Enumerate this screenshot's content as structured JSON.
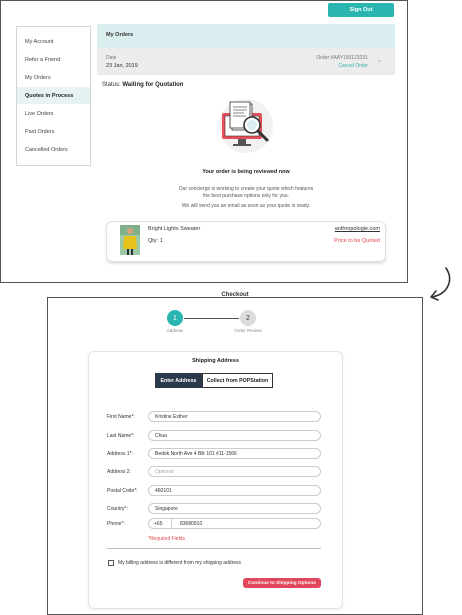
{
  "top": {
    "sign_out": "Sign Out",
    "sidebar": [
      "My Account",
      "Refer a Friend",
      "My Orders",
      "Quotes in Process",
      "Live Orders",
      "Past Orders",
      "Cancelled Orders"
    ],
    "orders_title": "My Orders",
    "date_label": "Date",
    "date_value": "23 Jan, 2019",
    "order_no": "Order #AAY190123231",
    "cancel_order": "Cancel Order",
    "status_prefix": "Status: ",
    "status_value": "Waiting for Quotation",
    "review_title": "Your order is being reviewed now",
    "message_1": "Our concierge is working to create your quote which features",
    "message_2": "the best purchase options only for you.",
    "message_3": "We will send you an email as soon as your quote is ready.",
    "product": {
      "name": "Bright Lights Sweater",
      "qty": "Qty: 1",
      "store": "anthropologie.com",
      "price": "Price to be Quoted"
    }
  },
  "bottom": {
    "checkout_title": "Checkout",
    "steps": [
      {
        "number": "1",
        "label": "Address"
      },
      {
        "number": "2",
        "label": "Order Review"
      }
    ],
    "heading": "Shipping Address",
    "tab_enter": "Enter Address",
    "tab_pop": "Collect from POPStation",
    "fields": {
      "first_name": {
        "label": "First Name*:",
        "value": "Kristine Esther"
      },
      "last_name": {
        "label": "Last Name*:",
        "value": "Chua"
      },
      "address1": {
        "label": "Address 1*:",
        "value": "Bedok North Ave 4 Blk 101 #11-1566"
      },
      "address2": {
        "label": "Address 2:",
        "placeholder": "Optional"
      },
      "postal": {
        "label": "Postal Code*:",
        "value": "460101"
      },
      "country": {
        "label": "Country*:",
        "value": "Singapore"
      },
      "phone": {
        "label": "Phone*:",
        "code": "+65",
        "value": "83680910"
      }
    },
    "required_note": "*Required Fields",
    "billing_checkbox": "My billing address is different from my shipping address",
    "continue": "Continue to Shipping Options"
  },
  "colors": {
    "accent": "#2bb5b0",
    "danger": "#e2464f",
    "header_bg": "#daeef0",
    "dark_button": "#2b3a4a"
  }
}
